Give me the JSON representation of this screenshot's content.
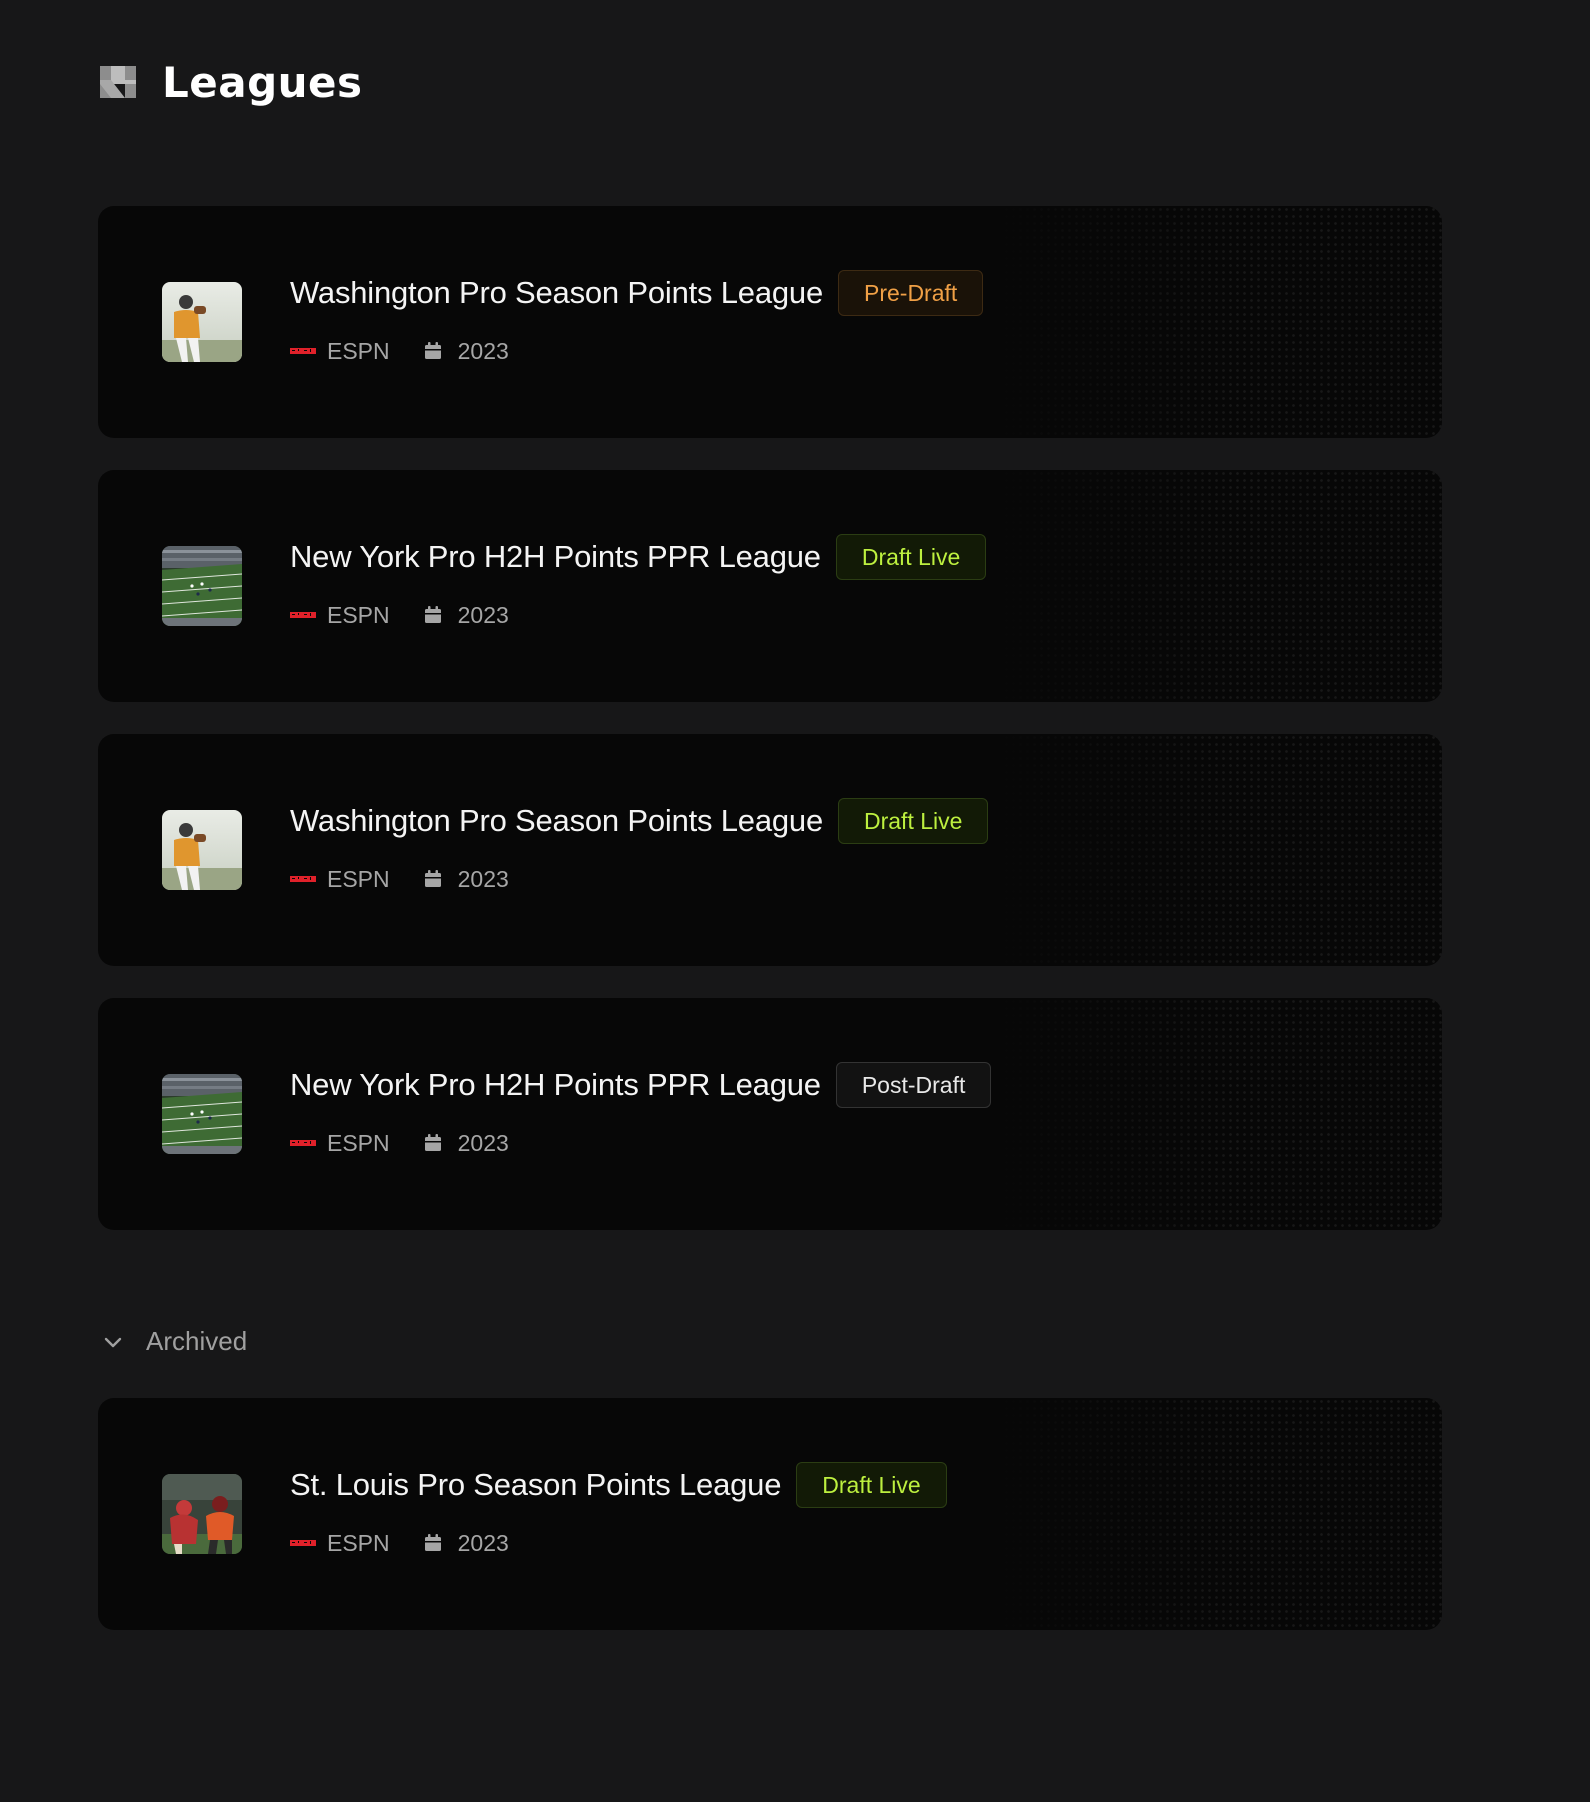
{
  "header": {
    "title": "Leagues",
    "logo_icon": "stacked-s-logo-icon"
  },
  "leagues": [
    {
      "name": "Washington Pro Season Points League",
      "status": "Pre-Draft",
      "status_kind": "pre",
      "provider": "ESPN",
      "season": "2023",
      "thumbnail": "quarterback-photo"
    },
    {
      "name": "New York Pro H2H Points PPR League",
      "status": "Draft Live",
      "status_kind": "live",
      "provider": "ESPN",
      "season": "2023",
      "thumbnail": "stadium-field-photo"
    },
    {
      "name": "Washington Pro Season Points League",
      "status": "Draft Live",
      "status_kind": "live",
      "provider": "ESPN",
      "season": "2023",
      "thumbnail": "quarterback-photo"
    },
    {
      "name": "New York Pro H2H Points PPR League",
      "status": "Post-Draft",
      "status_kind": "post",
      "provider": "ESPN",
      "season": "2023",
      "thumbnail": "stadium-field-photo"
    }
  ],
  "archived": {
    "label": "Archived",
    "expanded": true,
    "leagues": [
      {
        "name": "St. Louis Pro Season Points League",
        "status": "Draft Live",
        "status_kind": "live",
        "provider": "ESPN",
        "season": "2023",
        "thumbnail": "linemen-photo"
      }
    ]
  },
  "colors": {
    "page_background": "#171718",
    "card_background": "#070707",
    "pre_draft": "#f0a046",
    "draft_live": "#bdf03f",
    "post_draft": "#e8e8e8",
    "espn_red": "#e0212a"
  }
}
